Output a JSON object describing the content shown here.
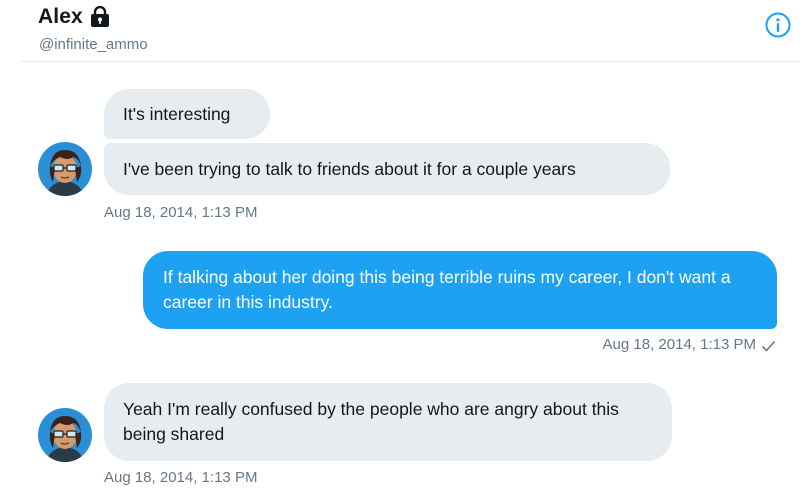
{
  "header": {
    "name": "Alex",
    "handle": "@infinite_ammo",
    "lock_icon": "lock-icon",
    "info_icon": "info-icon",
    "accent": "#1da1f2"
  },
  "messages": [
    {
      "direction": "in",
      "text": "It's interesting"
    },
    {
      "direction": "in",
      "text": "I've been trying to talk to friends about it for a couple years",
      "timestamp": "Aug 18, 2014, 1:13 PM"
    },
    {
      "direction": "out",
      "text": "If talking about her doing this being terrible ruins my career, I don't want a career in this industry.",
      "timestamp": "Aug 18, 2014, 1:13 PM",
      "status_icon": "checkmark-icon"
    },
    {
      "direction": "in",
      "text": "Yeah I'm really confused by the people who are angry about this being shared",
      "timestamp": "Aug 18, 2014, 1:13 PM"
    }
  ],
  "colors": {
    "incoming_bubble": "#e6ecf0",
    "outgoing_bubble": "#1da1f2",
    "secondary_text": "#657786"
  }
}
